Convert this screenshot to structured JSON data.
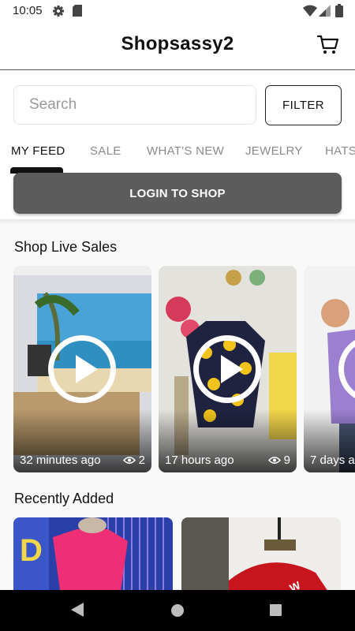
{
  "status_bar": {
    "time": "10:05"
  },
  "header": {
    "title": "Shopsassy2"
  },
  "search": {
    "placeholder": "Search",
    "filter_label": "FILTER"
  },
  "tabs": [
    {
      "label": "MY FEED",
      "active": true
    },
    {
      "label": "SALE",
      "active": false
    },
    {
      "label": "WHAT'S NEW",
      "active": false
    },
    {
      "label": "JEWELRY",
      "active": false
    },
    {
      "label": "HATS",
      "active": false
    }
  ],
  "login_label": "LOGIN TO SHOP",
  "live_sales": {
    "title": "Shop Live Sales",
    "items": [
      {
        "time": "32 minutes ago",
        "views": "2"
      },
      {
        "time": "17 hours ago",
        "views": "9"
      },
      {
        "time": "7 days a"
      }
    ]
  },
  "recently_added": {
    "title": "Recently Added"
  },
  "colors": {
    "login_button": "#5c5c5c",
    "nav_bar": "#000000",
    "accent": "#111111"
  },
  "icons": [
    "gear-icon",
    "sd-card-icon",
    "wifi-icon",
    "signal-icon",
    "battery-icon",
    "cart-icon",
    "play-icon",
    "eye-icon",
    "back-icon",
    "home-icon",
    "recents-icon"
  ]
}
